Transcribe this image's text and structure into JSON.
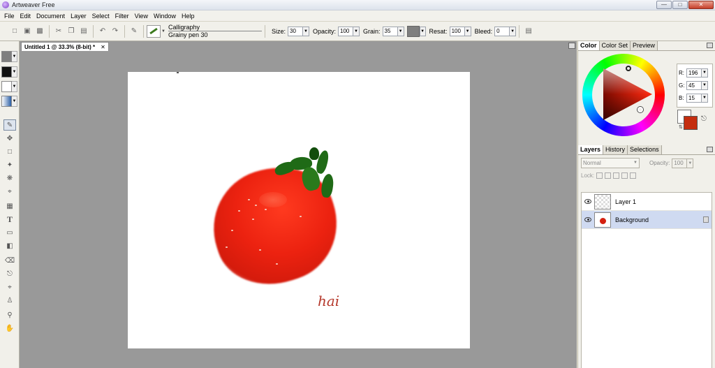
{
  "window": {
    "title": "Artweaver Free",
    "controls": {
      "minimize": "—",
      "maximize": "□",
      "close": "✕"
    }
  },
  "menu": [
    "File",
    "Edit",
    "Document",
    "Layer",
    "Select",
    "Filter",
    "View",
    "Window",
    "Help"
  ],
  "toolbar": {
    "icons": [
      "new-document-icon",
      "open-icon",
      "save-icon",
      "cut-icon",
      "copy-icon",
      "paste-icon",
      "undo-icon",
      "redo-icon",
      "brush-tool-icon"
    ],
    "brush_category": "Calligraphy",
    "brush_variant": "Grainy pen 30",
    "size_label": "Size:",
    "size_value": "30",
    "opacity_label": "Opacity:",
    "opacity_value": "100",
    "grain_label": "Grain:",
    "grain_value": "35",
    "resat_label": "Resat:",
    "resat_value": "100",
    "bleed_label": "Bleed:",
    "bleed_value": "0"
  },
  "document": {
    "tab_title": "Untitled 1 @ 33.3% (8-bit) *",
    "close_glyph": "✕",
    "signature": "hai"
  },
  "tools": [
    "brush-icon",
    "move-icon",
    "rectangle-select-icon",
    "magic-wand-icon",
    "lasso-icon",
    "crop-icon",
    "perspective-icon",
    "text-icon",
    "shape-icon",
    "gradient-icon",
    "eraser-icon",
    "clone-stamp-icon",
    "eyedropper-icon",
    "paint-bucket-icon",
    "zoom-icon",
    "hand-icon"
  ],
  "text_tool_glyph": "T",
  "color_panel": {
    "tabs": [
      "Color",
      "Color Set",
      "Preview"
    ],
    "active_tab": "Color",
    "r_label": "R:",
    "r": "196",
    "g_label": "G:",
    "g": "45",
    "b_label": "B:",
    "b": "15",
    "foreground_color": "#c42d0f",
    "background_color": "#ffffff"
  },
  "layers_panel": {
    "tabs": [
      "Layers",
      "History",
      "Selections"
    ],
    "active_tab": "Layers",
    "blend_mode": "Normal",
    "opacity_label": "Opacity:",
    "opacity_value": "100",
    "lock_label": "Lock:",
    "layers": [
      {
        "name": "Layer 1",
        "selected": false
      },
      {
        "name": "Background",
        "selected": true
      }
    ]
  }
}
